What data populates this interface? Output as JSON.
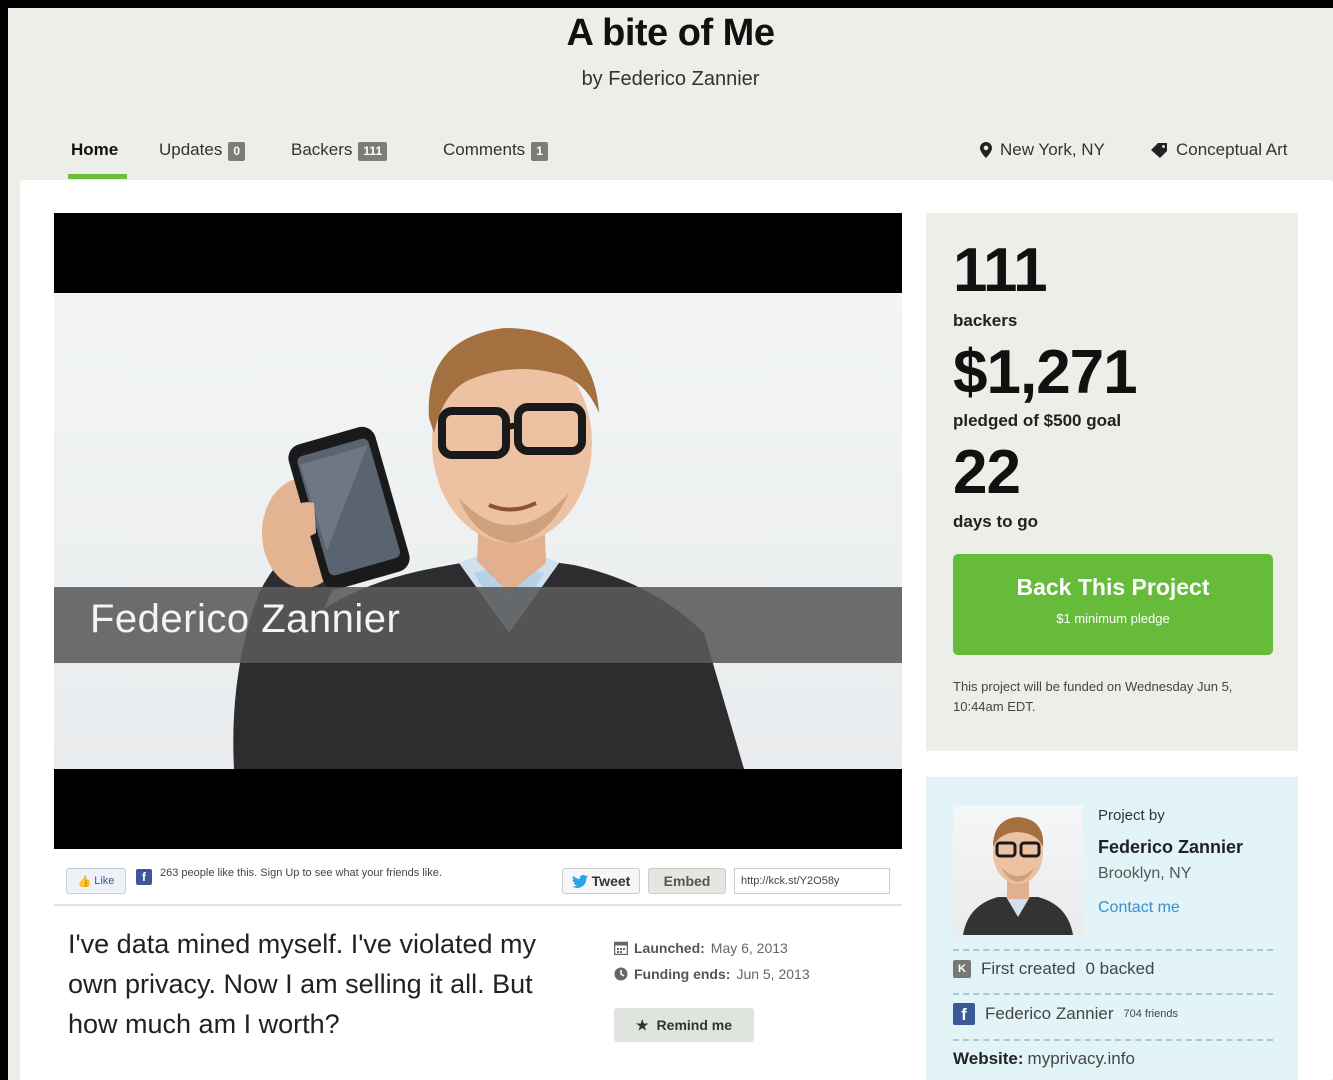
{
  "header": {
    "title": "A bite of Me",
    "byline": "by Federico Zannier"
  },
  "nav": {
    "home": "Home",
    "updates": {
      "label": "Updates",
      "count": "0"
    },
    "backers": {
      "label": "Backers",
      "count": "111"
    },
    "comments": {
      "label": "Comments",
      "count": "1"
    },
    "location": "New York, NY",
    "category": "Conceptual Art"
  },
  "video": {
    "caption": "Federico  Zannier"
  },
  "social": {
    "like_label": "Like",
    "like_text": "263 people like this. Sign Up to see what your friends like.",
    "tweet_label": "Tweet",
    "embed_label": "Embed",
    "short_url": "http://kck.st/Y2O58y"
  },
  "blurb": "I've data mined myself. I've violated my own privacy. Now I am selling it all. But how much am I worth?",
  "dates": {
    "launched_label": "Launched:",
    "launched_value": "May 6, 2013",
    "ends_label": "Funding ends:",
    "ends_value": "Jun 5, 2013",
    "remind_label": "Remind me"
  },
  "stats": {
    "backers_value": "111",
    "backers_label": "backers",
    "pledged_value": "$1,271",
    "pledged_label": "pledged of $500 goal",
    "days_value": "22",
    "days_label": "days to go",
    "back_button": "Back This Project",
    "min_pledge": "$1 minimum pledge",
    "fund_note": "This project will be funded on Wednesday Jun 5, 10:44am EDT."
  },
  "creator": {
    "caption": "Project by",
    "name": "Federico Zannier",
    "location": "Brooklyn, NY",
    "contact": "Contact me",
    "first_created": "First created",
    "backed": "0 backed",
    "facebook_name": "Federico Zannier",
    "facebook_friends": "704 friends",
    "website_label": "Website:",
    "website_value": "myprivacy.info"
  },
  "colors": {
    "accent_green": "#66bb3a",
    "facebook_blue": "#3b5998",
    "link_blue": "#3a8fd0"
  }
}
